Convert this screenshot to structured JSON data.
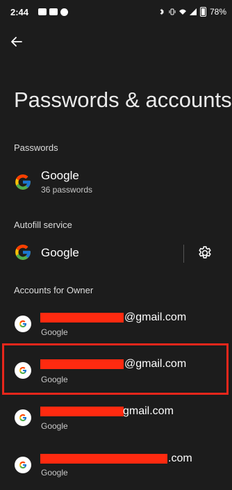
{
  "status_bar": {
    "time": "2:44",
    "battery": "78%"
  },
  "header": {
    "title": "Passwords & accounts"
  },
  "passwords_section": {
    "header": "Passwords",
    "provider": "Google",
    "count": "36 passwords"
  },
  "autofill_section": {
    "header": "Autofill service",
    "provider": "Google"
  },
  "accounts_section": {
    "header": "Accounts for Owner",
    "accounts": [
      {
        "email_visible": "@gmail.com",
        "type": "Google"
      },
      {
        "email_visible": "@gmail.com",
        "type": "Google"
      },
      {
        "email_visible": "gmail.com",
        "type": "Google"
      },
      {
        "email_visible": ".com",
        "type": "Google"
      }
    ]
  },
  "colors": {
    "background": "#1c1c1c",
    "redaction": "#ff2a10",
    "highlight": "#e8261b"
  }
}
